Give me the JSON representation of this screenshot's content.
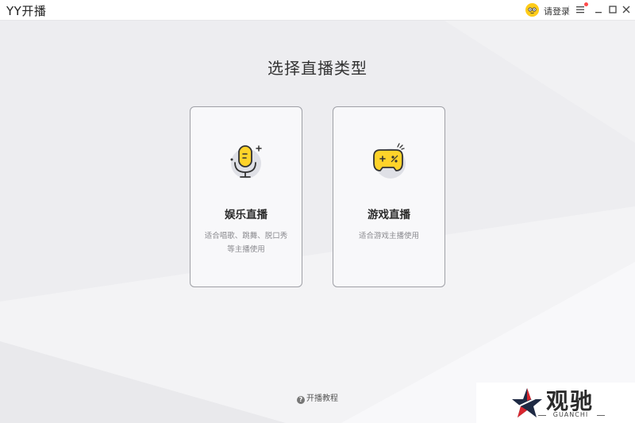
{
  "window": {
    "title": "YY开播",
    "login_label": "请登录"
  },
  "main": {
    "heading": "选择直播类型",
    "cards": [
      {
        "title": "娱乐直播",
        "description": "适合唱歌、跳舞、脱口秀等主播使用",
        "icon": "microphone-icon"
      },
      {
        "title": "游戏直播",
        "description": "适合游戏主播使用",
        "icon": "gamepad-icon"
      }
    ],
    "tutorial_label": "开播教程"
  },
  "watermark": {
    "brand": "观驰",
    "sub": "GUANCHI"
  },
  "colors": {
    "accent_yellow": "#ffd32a",
    "icon_bg": "#dfe0e6",
    "notification_dot": "#ff4b4b"
  }
}
